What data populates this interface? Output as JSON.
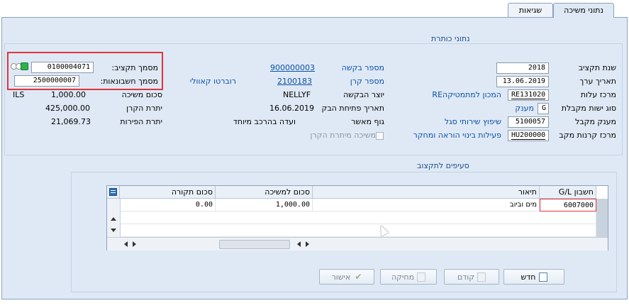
{
  "tabs": [
    {
      "label": "נתוני משיכה"
    },
    {
      "label": "שגיאות"
    }
  ],
  "header_section": {
    "title": "נתוני כותרת",
    "fields": {
      "fiscal_year_label": "שנת תקציב",
      "fiscal_year_value": "2018",
      "value_date_label": "תאריך ערך",
      "value_date_value": "13.06.2019",
      "cost_center_label": "מרכז עלות",
      "cost_center_value": "RE131020",
      "cost_center_desc": "המכון למתמטיקהRE",
      "recipient_type_label": "סוג ישות מקבלת",
      "recipient_type_value": "G",
      "recipient_type_desc": "מענק",
      "recipient_grant_label": "מענק מקבל",
      "recipient_grant_value": "5100057",
      "recipient_grant_desc": "שיפוץ שירותי סגל",
      "fund_center_label": "מרכז קרנות מקב",
      "fund_center_value": "HU200000",
      "fund_center_desc": "פעילות בינוי הוראה ומחקר",
      "request_no_label": "מספר בקשה",
      "request_no_value": "900000003",
      "fund_no_label": "מספר קרן",
      "fund_no_value": "2100183",
      "fund_no_owner": "רוברטו קאוולי",
      "creator_label": "יוצר הבקשה",
      "creator_value": "NELLYF",
      "open_date_label": "תאריך פתיחת הבק",
      "open_date_value": "16.06.2019",
      "approver_label": "גוף מאשר",
      "approver_value": "ועדה בהרכב מיוחד",
      "principal_withdrawal_label": "משיכה מיתרת הקרן",
      "budget_doc_label": "מסמך תקציב:",
      "budget_doc_value": "0100004071",
      "accounting_doc_label": "מסמך חשבונאות:",
      "accounting_doc_value": "2500000007",
      "withdrawal_amount_label": "סכום משיכה",
      "withdrawal_amount_value": "1,000.00",
      "withdrawal_currency": "ILS",
      "principal_balance_label": "יתרת הקרן",
      "principal_balance_value": "425,000.00",
      "revenue_balance_label": "יתרת הפירות",
      "revenue_balance_value": "21,069.73"
    }
  },
  "budget_section": {
    "title": "סעיפים לתקצוב",
    "columns": [
      "חשבון G/L",
      "תיאור",
      "סכום למשיכה",
      "סכום תקורה"
    ],
    "rows": [
      {
        "gl": "6007000",
        "desc": "מים וביוב",
        "amount": "1,000.00",
        "overhead": "0.00"
      }
    ]
  },
  "buttons": {
    "new": "חדש",
    "prev": "קודם",
    "delete": "מחיקה",
    "approve": "אישור"
  },
  "colors": {
    "accent_blue": "#0a4fa8",
    "highlight_red": "#e0353c",
    "status_green": "#2db34a"
  }
}
